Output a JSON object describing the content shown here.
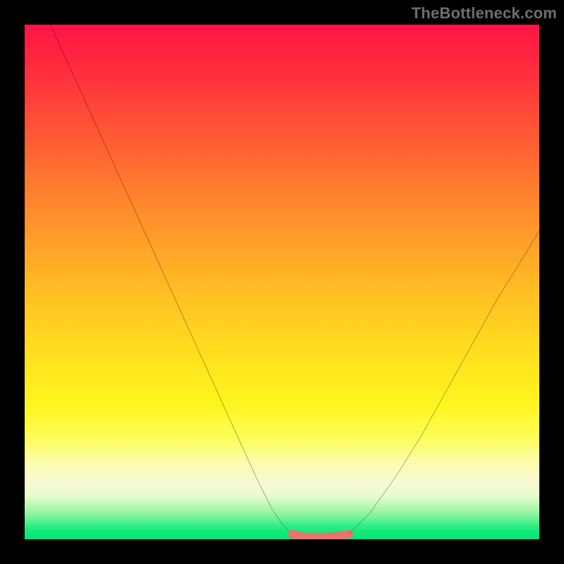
{
  "watermark": "TheBottleneck.com",
  "chart_data": {
    "type": "line",
    "title": "",
    "xlabel": "",
    "ylabel": "",
    "xlim": [
      0,
      100
    ],
    "ylim": [
      0,
      100
    ],
    "grid": false,
    "legend": false,
    "background_gradient": {
      "direction": "vertical",
      "stops": [
        {
          "pos": 0,
          "color": "#ff1445",
          "meaning": "high"
        },
        {
          "pos": 50,
          "color": "#ffc722",
          "meaning": "mid"
        },
        {
          "pos": 85,
          "color": "#fcfcac",
          "meaning": "near-low"
        },
        {
          "pos": 100,
          "color": "#00e676",
          "meaning": "low"
        }
      ]
    },
    "series": [
      {
        "name": "left-branch",
        "stroke": "#000000",
        "x": [
          5,
          10,
          15,
          20,
          25,
          30,
          35,
          40,
          45,
          48,
          50,
          52
        ],
        "y": [
          100,
          89,
          78,
          67,
          56,
          45,
          34,
          23,
          12,
          6,
          3,
          1
        ]
      },
      {
        "name": "flat-minimum",
        "stroke": "#e9736d",
        "thick": true,
        "x": [
          52,
          54,
          56,
          58,
          60,
          62,
          63
        ],
        "y": [
          1,
          0.5,
          0.4,
          0.4,
          0.5,
          0.8,
          1
        ]
      },
      {
        "name": "right-branch",
        "stroke": "#000000",
        "x": [
          63,
          67,
          72,
          77,
          82,
          87,
          92,
          97,
          100
        ],
        "y": [
          1,
          5,
          12,
          20,
          29,
          38,
          47,
          55,
          60
        ]
      }
    ],
    "annotations": []
  }
}
